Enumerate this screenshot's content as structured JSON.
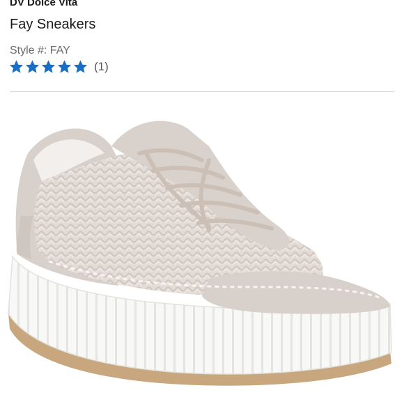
{
  "product": {
    "brand": "DV Dolce Vita",
    "name": "Fay Sneakers",
    "style_label": "Style #: FAY",
    "rating": {
      "stars": 5,
      "max_stars": 5,
      "review_count_text": "(1)",
      "star_color": "#1a6fc4"
    }
  },
  "image": {
    "subject": "sneaker-photo",
    "colors": {
      "upper": "#d9d2cc",
      "weave": "#e6dfda",
      "sole": "#f7f7f5",
      "outsole": "#c9a77e"
    }
  }
}
